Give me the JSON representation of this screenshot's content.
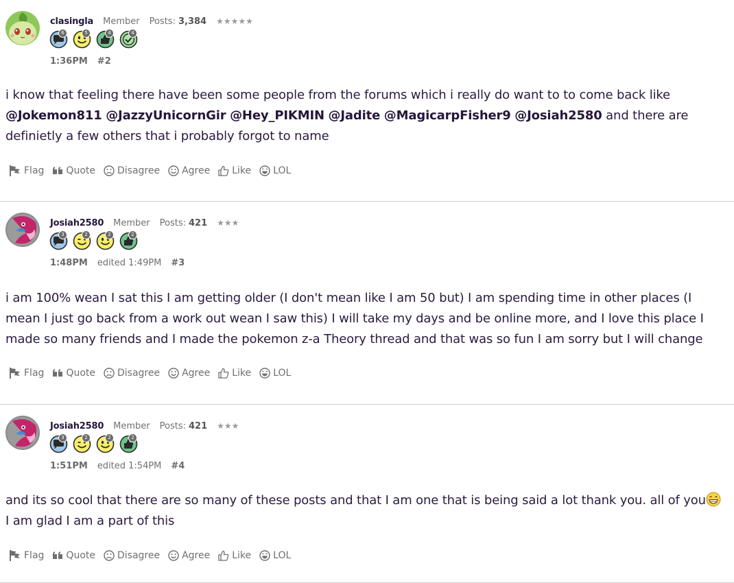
{
  "posts": [
    {
      "username": "clasingla",
      "role": "Member",
      "posts_label": "Posts:",
      "posts_count": "3,384",
      "stars": "★★★★★",
      "badges": [
        {
          "icon": "speech-bubble-icon",
          "count": "6"
        },
        {
          "icon": "smiley-face-icon",
          "count": "5"
        },
        {
          "icon": "thumbs-up-icon",
          "count": "4"
        },
        {
          "icon": "check-circle-icon",
          "count": "4"
        }
      ],
      "time": "1:36PM",
      "edited": "",
      "number": "#2",
      "body_segments": [
        "i know that feeling there have been some people from the forums which i really do want to to come back like ",
        "@Jokemon811",
        " ",
        "@JazzyUnicornGir",
        " ",
        "@Hey_PIKMIN",
        " ",
        "@Jadite",
        " ",
        "@MagicarpFisher9",
        " ",
        "@Josiah2580",
        " and there are definietly a few others that i probably forgot to name"
      ]
    },
    {
      "username": "Josiah2580",
      "role": "Member",
      "posts_label": "Posts:",
      "posts_count": "421",
      "stars": "★★★",
      "badges": [
        {
          "icon": "speech-bubble-icon",
          "count": "3"
        },
        {
          "icon": "winking-face-icon",
          "count": "2"
        },
        {
          "icon": "smiley-face-icon",
          "count": "2"
        },
        {
          "icon": "thumbs-up-icon",
          "count": "2"
        }
      ],
      "time": "1:48PM",
      "edited": "edited 1:49PM",
      "number": "#3",
      "body": "i am 100% wean I sat this I am getting older (I don't mean like I am 50 but) I am spending time in other places (I mean I just go back from a work out wean I saw this) I will take my days and be online more, and I love this place I made so many friends and I made the pokemon z-a Theory thread and that was so fun I am sorry but I will change"
    },
    {
      "username": "Josiah2580",
      "role": "Member",
      "posts_label": "Posts:",
      "posts_count": "421",
      "stars": "★★★",
      "badges": [
        {
          "icon": "speech-bubble-icon",
          "count": "3"
        },
        {
          "icon": "winking-face-icon",
          "count": "2"
        },
        {
          "icon": "smiley-face-icon",
          "count": "2"
        },
        {
          "icon": "thumbs-up-icon",
          "count": "2"
        }
      ],
      "time": "1:51PM",
      "edited": "edited 1:54PM",
      "number": "#4",
      "body_line1": "and its so cool that there are so many of these posts and that I am one that is being said a lot thank you. all of you",
      "body_emoji": "grinning-face-icon",
      "body_line2": "I am glad I am a part of this"
    }
  ],
  "actions": {
    "flag": "Flag",
    "quote": "Quote",
    "disagree": "Disagree",
    "agree": "Agree",
    "like": "Like",
    "lol": "LOL"
  },
  "colors": {
    "text": "#2b1a3f",
    "meta": "#707070",
    "divider": "#cfcfcf"
  }
}
